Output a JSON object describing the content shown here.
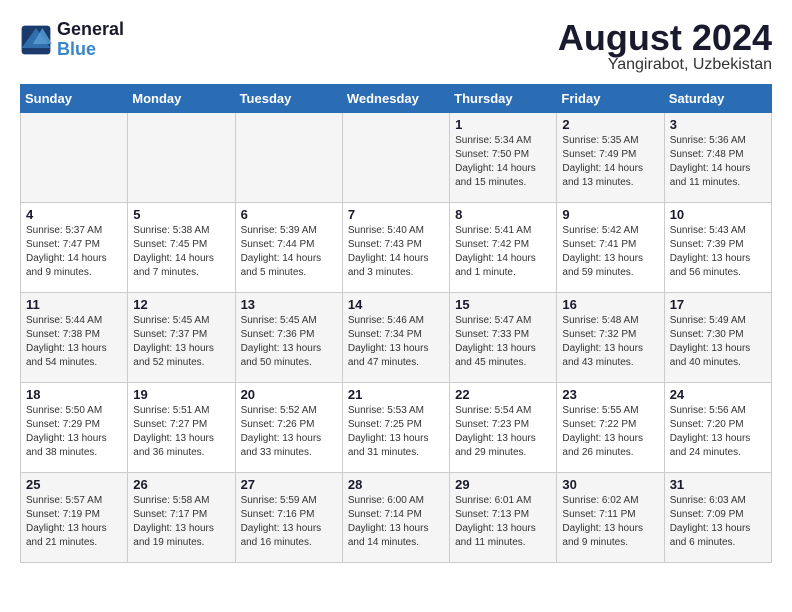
{
  "header": {
    "logo_line1": "General",
    "logo_line2": "Blue",
    "month_year": "August 2024",
    "location": "Yangirabot, Uzbekistan"
  },
  "weekdays": [
    "Sunday",
    "Monday",
    "Tuesday",
    "Wednesday",
    "Thursday",
    "Friday",
    "Saturday"
  ],
  "weeks": [
    [
      {
        "day": "",
        "info": ""
      },
      {
        "day": "",
        "info": ""
      },
      {
        "day": "",
        "info": ""
      },
      {
        "day": "",
        "info": ""
      },
      {
        "day": "1",
        "info": "Sunrise: 5:34 AM\nSunset: 7:50 PM\nDaylight: 14 hours\nand 15 minutes."
      },
      {
        "day": "2",
        "info": "Sunrise: 5:35 AM\nSunset: 7:49 PM\nDaylight: 14 hours\nand 13 minutes."
      },
      {
        "day": "3",
        "info": "Sunrise: 5:36 AM\nSunset: 7:48 PM\nDaylight: 14 hours\nand 11 minutes."
      }
    ],
    [
      {
        "day": "4",
        "info": "Sunrise: 5:37 AM\nSunset: 7:47 PM\nDaylight: 14 hours\nand 9 minutes."
      },
      {
        "day": "5",
        "info": "Sunrise: 5:38 AM\nSunset: 7:45 PM\nDaylight: 14 hours\nand 7 minutes."
      },
      {
        "day": "6",
        "info": "Sunrise: 5:39 AM\nSunset: 7:44 PM\nDaylight: 14 hours\nand 5 minutes."
      },
      {
        "day": "7",
        "info": "Sunrise: 5:40 AM\nSunset: 7:43 PM\nDaylight: 14 hours\nand 3 minutes."
      },
      {
        "day": "8",
        "info": "Sunrise: 5:41 AM\nSunset: 7:42 PM\nDaylight: 14 hours\nand 1 minute."
      },
      {
        "day": "9",
        "info": "Sunrise: 5:42 AM\nSunset: 7:41 PM\nDaylight: 13 hours\nand 59 minutes."
      },
      {
        "day": "10",
        "info": "Sunrise: 5:43 AM\nSunset: 7:39 PM\nDaylight: 13 hours\nand 56 minutes."
      }
    ],
    [
      {
        "day": "11",
        "info": "Sunrise: 5:44 AM\nSunset: 7:38 PM\nDaylight: 13 hours\nand 54 minutes."
      },
      {
        "day": "12",
        "info": "Sunrise: 5:45 AM\nSunset: 7:37 PM\nDaylight: 13 hours\nand 52 minutes."
      },
      {
        "day": "13",
        "info": "Sunrise: 5:45 AM\nSunset: 7:36 PM\nDaylight: 13 hours\nand 50 minutes."
      },
      {
        "day": "14",
        "info": "Sunrise: 5:46 AM\nSunset: 7:34 PM\nDaylight: 13 hours\nand 47 minutes."
      },
      {
        "day": "15",
        "info": "Sunrise: 5:47 AM\nSunset: 7:33 PM\nDaylight: 13 hours\nand 45 minutes."
      },
      {
        "day": "16",
        "info": "Sunrise: 5:48 AM\nSunset: 7:32 PM\nDaylight: 13 hours\nand 43 minutes."
      },
      {
        "day": "17",
        "info": "Sunrise: 5:49 AM\nSunset: 7:30 PM\nDaylight: 13 hours\nand 40 minutes."
      }
    ],
    [
      {
        "day": "18",
        "info": "Sunrise: 5:50 AM\nSunset: 7:29 PM\nDaylight: 13 hours\nand 38 minutes."
      },
      {
        "day": "19",
        "info": "Sunrise: 5:51 AM\nSunset: 7:27 PM\nDaylight: 13 hours\nand 36 minutes."
      },
      {
        "day": "20",
        "info": "Sunrise: 5:52 AM\nSunset: 7:26 PM\nDaylight: 13 hours\nand 33 minutes."
      },
      {
        "day": "21",
        "info": "Sunrise: 5:53 AM\nSunset: 7:25 PM\nDaylight: 13 hours\nand 31 minutes."
      },
      {
        "day": "22",
        "info": "Sunrise: 5:54 AM\nSunset: 7:23 PM\nDaylight: 13 hours\nand 29 minutes."
      },
      {
        "day": "23",
        "info": "Sunrise: 5:55 AM\nSunset: 7:22 PM\nDaylight: 13 hours\nand 26 minutes."
      },
      {
        "day": "24",
        "info": "Sunrise: 5:56 AM\nSunset: 7:20 PM\nDaylight: 13 hours\nand 24 minutes."
      }
    ],
    [
      {
        "day": "25",
        "info": "Sunrise: 5:57 AM\nSunset: 7:19 PM\nDaylight: 13 hours\nand 21 minutes."
      },
      {
        "day": "26",
        "info": "Sunrise: 5:58 AM\nSunset: 7:17 PM\nDaylight: 13 hours\nand 19 minutes."
      },
      {
        "day": "27",
        "info": "Sunrise: 5:59 AM\nSunset: 7:16 PM\nDaylight: 13 hours\nand 16 minutes."
      },
      {
        "day": "28",
        "info": "Sunrise: 6:00 AM\nSunset: 7:14 PM\nDaylight: 13 hours\nand 14 minutes."
      },
      {
        "day": "29",
        "info": "Sunrise: 6:01 AM\nSunset: 7:13 PM\nDaylight: 13 hours\nand 11 minutes."
      },
      {
        "day": "30",
        "info": "Sunrise: 6:02 AM\nSunset: 7:11 PM\nDaylight: 13 hours\nand 9 minutes."
      },
      {
        "day": "31",
        "info": "Sunrise: 6:03 AM\nSunset: 7:09 PM\nDaylight: 13 hours\nand 6 minutes."
      }
    ]
  ]
}
